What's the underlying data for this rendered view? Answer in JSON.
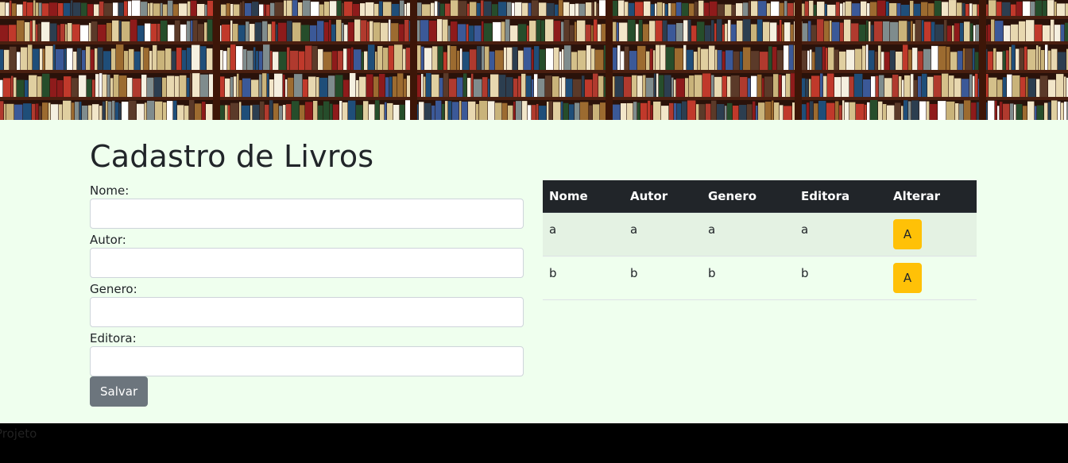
{
  "page": {
    "title": "Cadastro de Livros"
  },
  "form": {
    "fields": [
      {
        "label": "Nome:",
        "value": ""
      },
      {
        "label": "Autor:",
        "value": ""
      },
      {
        "label": "Genero:",
        "value": ""
      },
      {
        "label": "Editora:",
        "value": ""
      }
    ],
    "save_label": "Salvar"
  },
  "table": {
    "headers": [
      "Nome",
      "Autor",
      "Genero",
      "Editora",
      "Alterar"
    ],
    "rows": [
      {
        "nome": "a",
        "autor": "a",
        "genero": "a",
        "editora": "a",
        "action": "A"
      },
      {
        "nome": "b",
        "autor": "b",
        "genero": "b",
        "editora": "b",
        "action": "A"
      }
    ]
  },
  "footer": {
    "text": "Projeto"
  },
  "colors": {
    "background": "#efffee",
    "header_dark": "#212529",
    "save_button": "#6c757d",
    "alter_button": "#ffc107"
  },
  "banner": {
    "image": "bookshelf-photo"
  }
}
